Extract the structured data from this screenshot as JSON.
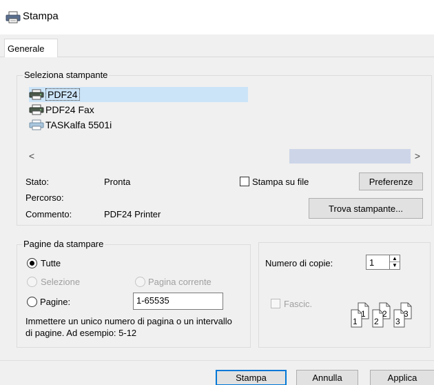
{
  "window": {
    "title": "Stampa",
    "icon": "printer-icon"
  },
  "tabs": [
    {
      "label": "Generale",
      "selected": true
    }
  ],
  "printer_group": {
    "legend": "Seleziona stampante",
    "printers": [
      {
        "name": "PDF24",
        "icon": "printer-icon",
        "selected": true
      },
      {
        "name": "PDF24 Fax",
        "icon": "fax-printer-icon",
        "selected": false
      },
      {
        "name": "TASKalfa 5501i",
        "icon": "network-printer-icon",
        "selected": false
      }
    ],
    "scroll_left": "<",
    "scroll_right": ">",
    "status_label": "Stato:",
    "status_value": "Pronta",
    "path_label": "Percorso:",
    "path_value": "",
    "comment_label": "Commento:",
    "comment_value": "PDF24 Printer",
    "print_to_file_label": "Stampa su file",
    "print_to_file_checked": false,
    "preferences_button": "Preferenze",
    "find_printer_button": "Trova stampante..."
  },
  "pages_group": {
    "legend": "Pagine da stampare",
    "all_label": "Tutte",
    "all_checked": true,
    "selection_label": "Selezione",
    "current_page_label": "Pagina corrente",
    "pages_label": "Pagine:",
    "pages_value": "1-65535",
    "hint": "Immettere un unico numero di pagina o un intervallo di pagine. Ad esempio: 5-12"
  },
  "copies_group": {
    "copies_label": "Numero di copie:",
    "copies_value": "1",
    "collate_label": "Fascic.",
    "collate_checked": false,
    "collate_pages": [
      "1",
      "1",
      "2",
      "2",
      "3",
      "3"
    ]
  },
  "buttons": {
    "print": "Stampa",
    "cancel": "Annulla",
    "apply": "Applica"
  },
  "colors": {
    "accent": "#0078d7",
    "selection_bg": "#cce4f7",
    "dialog_bg": "#f0f0f0",
    "scroll_thumb": "#cdd5e8"
  }
}
